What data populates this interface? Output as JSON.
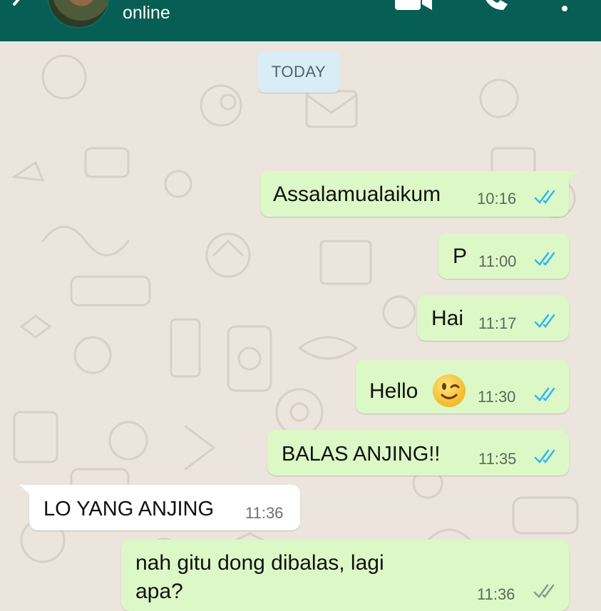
{
  "header": {
    "status": "online",
    "background_color": "#075e54"
  },
  "chat": {
    "date_label": "TODAY",
    "messages": [
      {
        "direction": "out",
        "text": "Assalamualaikum",
        "time": "10:16",
        "read": true
      },
      {
        "direction": "out",
        "text": "P",
        "time": "11:00",
        "read": true
      },
      {
        "direction": "out",
        "text": "Hai",
        "time": "11:17",
        "read": true
      },
      {
        "direction": "out",
        "text": "Hello",
        "emoji": "winking-face",
        "time": "11:30",
        "read": true
      },
      {
        "direction": "out",
        "text": "BALAS ANJING!!",
        "time": "11:35",
        "read": true
      },
      {
        "direction": "in",
        "text": "LO YANG ANJING",
        "time": "11:36"
      },
      {
        "direction": "out",
        "text_line1": "nah gitu dong dibalas, lagi",
        "text_line2": "apa?",
        "time": "11:36",
        "read": false
      }
    ]
  },
  "colors": {
    "outgoing_bubble": "#dcf8c6",
    "incoming_bubble": "#ffffff",
    "read_ticks": "#34b7f1",
    "unread_ticks": "#8a9a8a",
    "chat_background": "#ece5dd"
  }
}
